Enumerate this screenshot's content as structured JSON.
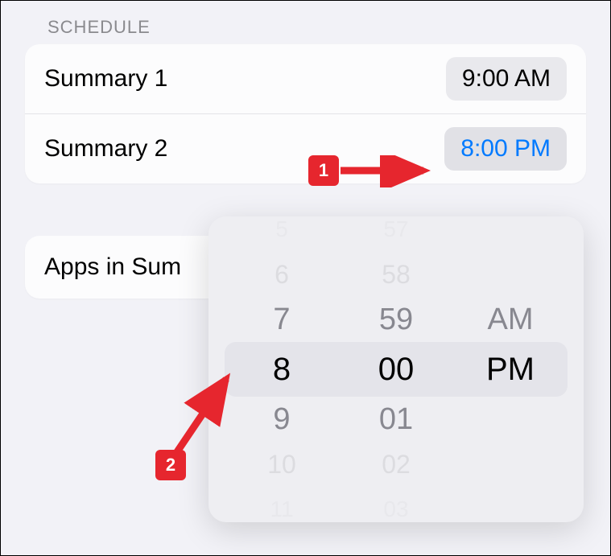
{
  "section_header": "SCHEDULE",
  "schedule": [
    {
      "label": "Summary 1",
      "time": "9:00 AM"
    },
    {
      "label": "Summary 2",
      "time": "8:00 PM"
    }
  ],
  "apps_label": "Apps in Sum",
  "picker": {
    "hours": [
      "5",
      "6",
      "7",
      "8",
      "9",
      "10",
      "11"
    ],
    "minutes": [
      "57",
      "58",
      "59",
      "00",
      "01",
      "02",
      "03"
    ],
    "periods": [
      "AM",
      "PM"
    ],
    "selected_hour": "8",
    "selected_minute": "00",
    "selected_period": "PM"
  },
  "callouts": {
    "one": "1",
    "two": "2"
  }
}
